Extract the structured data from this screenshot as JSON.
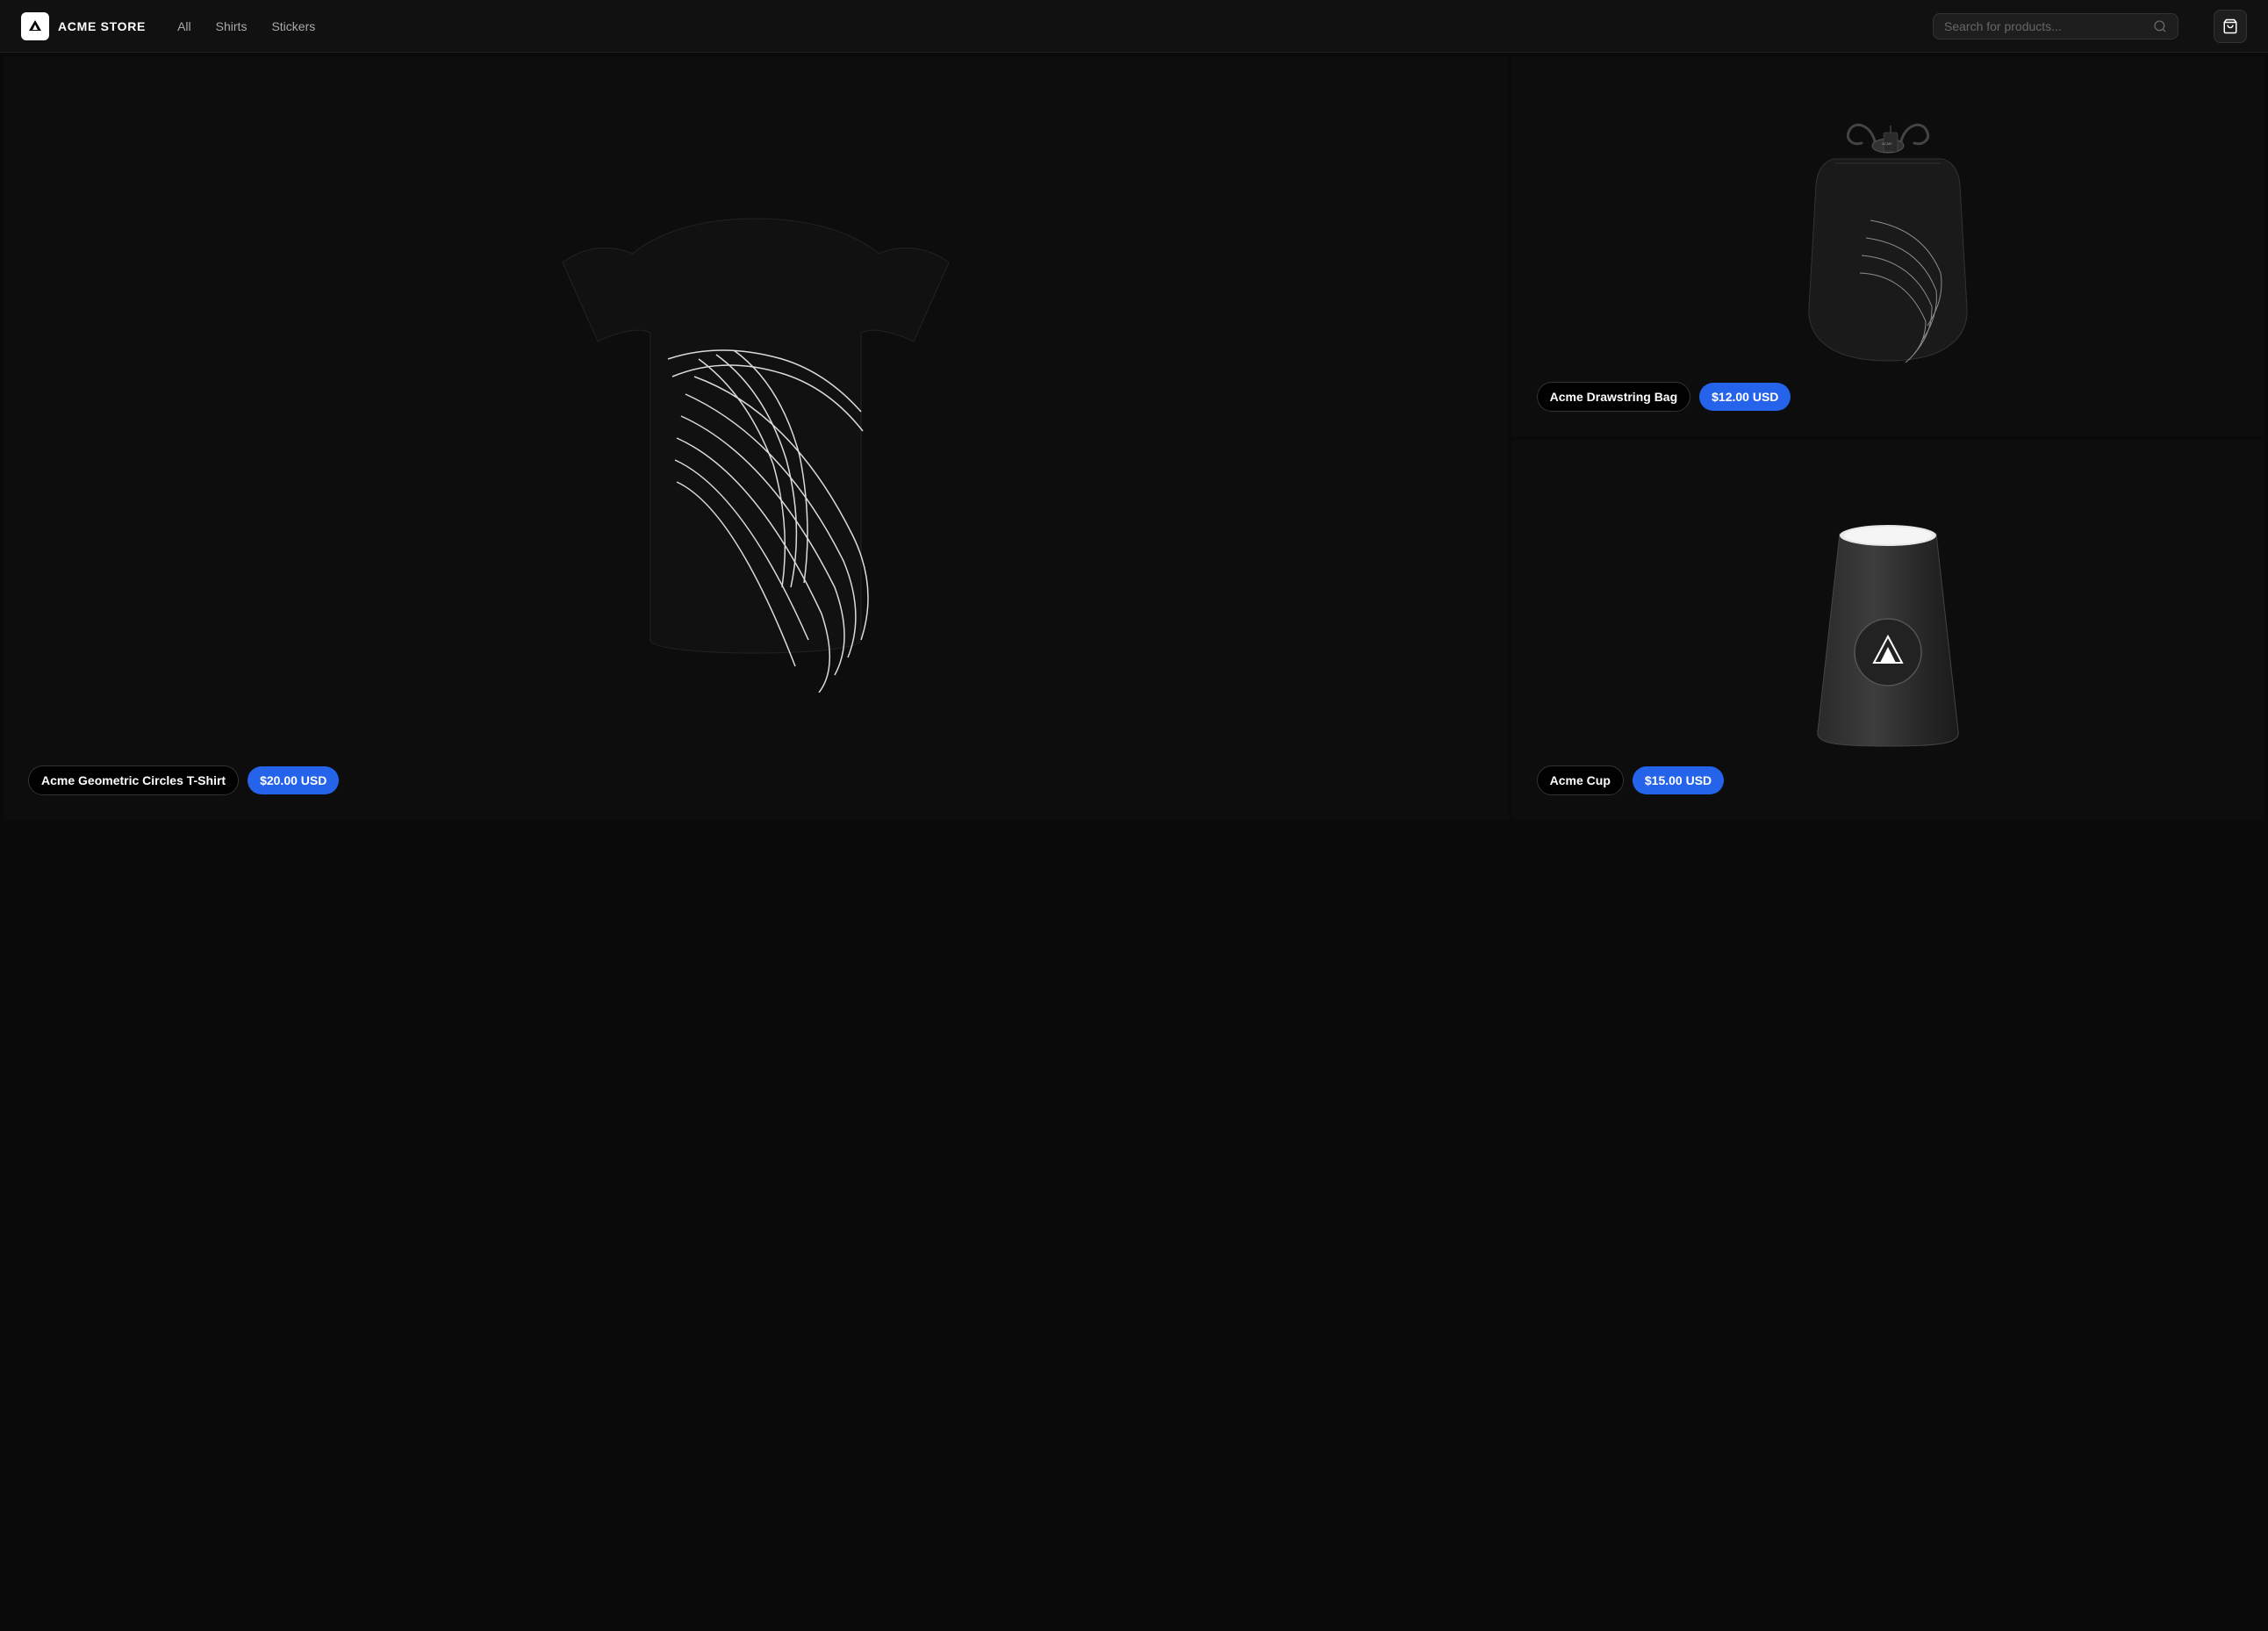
{
  "navbar": {
    "brand_name": "ACME STORE",
    "nav_links": [
      {
        "id": "all",
        "label": "All"
      },
      {
        "id": "shirts",
        "label": "Shirts"
      },
      {
        "id": "stickers",
        "label": "Stickers"
      }
    ],
    "search_placeholder": "Search for products..."
  },
  "products": [
    {
      "id": "tshirt",
      "name": "Acme Geometric Circles T-Shirt",
      "price": "$20.00 USD",
      "size": "large"
    },
    {
      "id": "bag",
      "name": "Acme Drawstring Bag",
      "price": "$12.00 USD",
      "size": "small"
    },
    {
      "id": "cup",
      "name": "Acme Cup",
      "price": "$15.00 USD",
      "size": "small"
    }
  ],
  "icons": {
    "search": "🔍",
    "cart": "🛒",
    "logo": "▲"
  }
}
